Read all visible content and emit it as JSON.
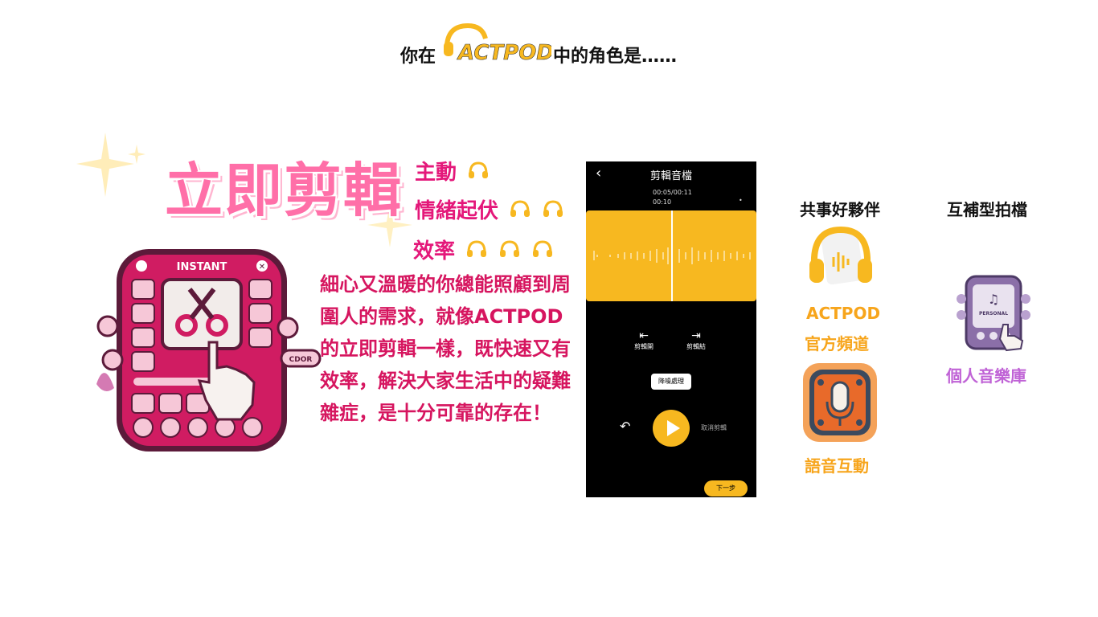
{
  "header": {
    "prefix": "你在",
    "logo_text": "ACTPOD",
    "suffix": "中的角色是……"
  },
  "role": {
    "title": "立即剪輯",
    "stats": [
      {
        "label": "主動",
        "level": 1
      },
      {
        "label": "情緒起伏",
        "level": 2
      },
      {
        "label": "效率",
        "level": 3
      }
    ],
    "description": "細心又溫暖的你總能照顧到周圍人的需求，就像ACTPOD的立即剪輯一樣，既快速又有效率，解決大家生活中的疑難雜症，是十分可靠的存在！",
    "illustration_labels": {
      "top": "INSTANT",
      "side": "CDOR"
    }
  },
  "phone": {
    "title": "剪輯音檔",
    "time_current": "00:05/00:11",
    "time_marker": "00:10",
    "cut_start_label": "剪輯開",
    "cut_end_label": "剪輯結",
    "denoise_label": "降噪處理",
    "cancel_label": "取消剪輯",
    "next_label": "下一步"
  },
  "partners": {
    "good_partner_heading": "共事好夥伴",
    "complement_heading": "互補型拍檔",
    "actpod_label": "ACTPOD",
    "official_channel_label": "官方頻道",
    "voice_interaction_label": "語音互動",
    "personal_library_label": "個人音樂庫",
    "personal_library_art_text": "PERSONAL"
  },
  "colors": {
    "accent_pink": "#e4187a",
    "title_pink": "#ff6fa8",
    "brand_yellow": "#f7b820",
    "purple": "#c063d6"
  }
}
